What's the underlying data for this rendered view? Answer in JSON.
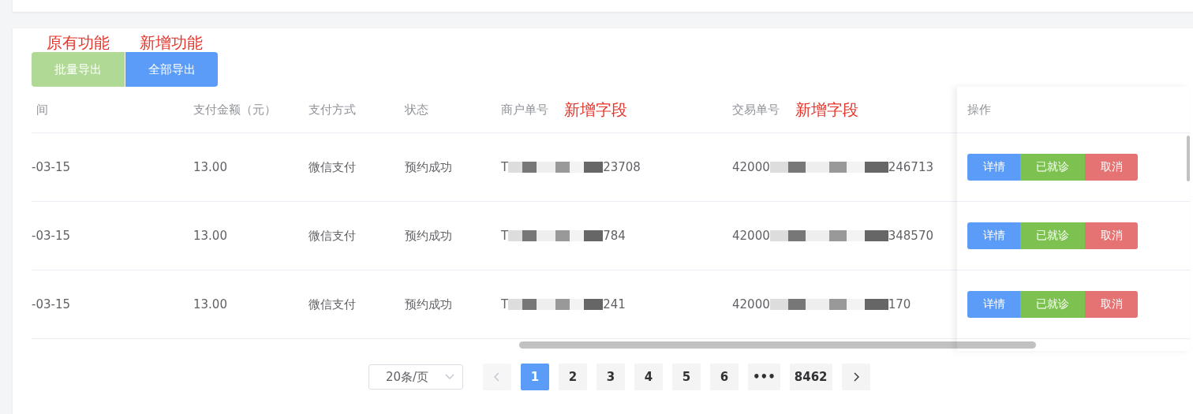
{
  "toolbar": {
    "buttons": [
      {
        "label": "批量导出",
        "note": "原有功能",
        "kind": "success",
        "disabled": true
      },
      {
        "label": "全部导出",
        "note": "新增功能",
        "kind": "primary",
        "disabled": false
      }
    ]
  },
  "table": {
    "columns": [
      {
        "label": "间"
      },
      {
        "label": "支付金额（元）"
      },
      {
        "label": "支付方式"
      },
      {
        "label": "状态"
      },
      {
        "label": "商户单号",
        "note": "新增字段"
      },
      {
        "label": "交易单号",
        "note": "新增字段"
      }
    ],
    "action_column": {
      "label": "操作"
    },
    "rows": [
      {
        "cells": [
          "-03-15",
          "13.00",
          "微信支付",
          "预约成功"
        ],
        "merchant_no": {
          "start": "T",
          "end": "23708"
        },
        "trade_no": {
          "start": "42000",
          "end": "246713"
        },
        "actions": [
          {
            "label": "详情",
            "kind": "primary"
          },
          {
            "label": "已就诊",
            "kind": "success"
          },
          {
            "label": "取消",
            "kind": "danger"
          }
        ]
      },
      {
        "cells": [
          "-03-15",
          "13.00",
          "微信支付",
          "预约成功"
        ],
        "merchant_no": {
          "start": "T",
          "end": "784"
        },
        "trade_no": {
          "start": "42000",
          "end": "348570"
        },
        "actions": [
          {
            "label": "详情",
            "kind": "primary"
          },
          {
            "label": "已就诊",
            "kind": "success"
          },
          {
            "label": "取消",
            "kind": "danger"
          }
        ]
      },
      {
        "cells": [
          "-03-15",
          "13.00",
          "微信支付",
          "预约成功"
        ],
        "merchant_no": {
          "start": "T",
          "end": "241"
        },
        "trade_no": {
          "start": "42000",
          "end": "170"
        },
        "actions": [
          {
            "label": "详情",
            "kind": "primary"
          },
          {
            "label": "已就诊",
            "kind": "success"
          },
          {
            "label": "取消",
            "kind": "danger"
          }
        ]
      }
    ]
  },
  "pagination": {
    "page_size": "20条/页",
    "prev_disabled": true,
    "pages": [
      {
        "label": "1",
        "selected": true
      },
      {
        "label": "2",
        "selected": false
      },
      {
        "label": "3",
        "selected": false
      },
      {
        "label": "4",
        "selected": false
      },
      {
        "label": "5",
        "selected": false
      },
      {
        "label": "6",
        "selected": false
      },
      {
        "label": "•••",
        "selected": false
      },
      {
        "label": "8462",
        "selected": false
      }
    ]
  }
}
